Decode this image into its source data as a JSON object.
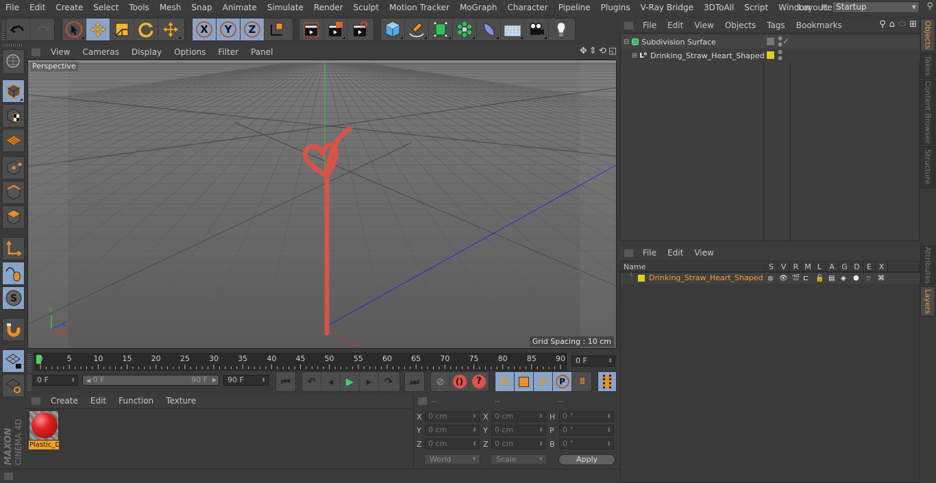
{
  "app": {
    "name": "Cinema 4D",
    "brand_vertical": "MAXON CINEMA 4D"
  },
  "menubar": {
    "items": [
      "File",
      "Edit",
      "Create",
      "Select",
      "Tools",
      "Mesh",
      "Snap",
      "Animate",
      "Simulate",
      "Render",
      "Sculpt",
      "Motion Tracker",
      "MoGraph",
      "Character",
      "Pipeline",
      "Plugins",
      "V-Ray Bridge",
      "3DToAll",
      "Script",
      "Window",
      "Help"
    ],
    "layout_label": "Layout:",
    "layout_value": "Startup"
  },
  "toolbar": {
    "icons": [
      "undo-icon",
      "redo-icon",
      "live-selection-icon",
      "move-icon",
      "scale-icon",
      "rotate-icon",
      "transform-icon",
      "x-axis-lock-icon",
      "y-axis-lock-icon",
      "z-axis-lock-icon",
      "coordinate-system-icon",
      "render-view-icon",
      "render-picture-viewer-icon",
      "render-settings-icon",
      "cube-icon",
      "pen-icon",
      "subdivision-icon",
      "mograph-cloner-icon",
      "deformer-icon",
      "floor-icon",
      "camera-icon",
      "light-icon"
    ]
  },
  "left_palette": {
    "icons": [
      "make-editable-icon",
      "model-mode-icon",
      "texture-mode-icon",
      "workplane-mode-icon",
      "points-mode-icon",
      "edges-mode-icon",
      "polygons-mode-icon",
      "axis-mode-icon",
      "tweak-mode-icon",
      "solo-mode-icon",
      "snapping-icon",
      "lock-workplane-icon",
      "workplane-align-icon"
    ]
  },
  "viewport": {
    "menu": [
      "View",
      "Cameras",
      "Display",
      "Options",
      "Filter",
      "Panel"
    ],
    "camera_label": "Perspective",
    "grid_spacing": "Grid Spacing : 10 cm",
    "axis_labels": {
      "x": "X",
      "y": "Y",
      "z": "Z"
    },
    "object_color": "#d9534a"
  },
  "timeline": {
    "ticks": [
      "0",
      "5",
      "10",
      "15",
      "20",
      "25",
      "30",
      "35",
      "40",
      "45",
      "50",
      "55",
      "60",
      "65",
      "70",
      "75",
      "80",
      "85",
      "90"
    ],
    "current_frame": "0 F",
    "start_field": "0 F",
    "range_start": "0 F",
    "range_end": "90 F",
    "end_field": "90 F",
    "min_frame": 0,
    "max_frame": 90,
    "playhead_frame": 0
  },
  "material_manager": {
    "menu": [
      "Create",
      "Edit",
      "Function",
      "Texture"
    ],
    "materials": [
      {
        "name": "Plastic_D",
        "color": "#d02020"
      }
    ]
  },
  "coordinates": {
    "headers": [
      "--",
      "--",
      "--"
    ],
    "rows": [
      {
        "pos_label": "X",
        "pos": "0 cm",
        "size_label": "X",
        "size": "0 cm",
        "rot_label": "H",
        "rot": "0 °"
      },
      {
        "pos_label": "Y",
        "pos": "0 cm",
        "size_label": "Y",
        "size": "0 cm",
        "rot_label": "P",
        "rot": "0 °"
      },
      {
        "pos_label": "Z",
        "pos": "0 cm",
        "size_label": "Z",
        "size": "0 cm",
        "rot_label": "B",
        "rot": "0 °"
      }
    ],
    "space_select": "World",
    "mode_select": "Scale",
    "apply_label": "Apply"
  },
  "object_manager": {
    "menu": [
      "File",
      "Edit",
      "View",
      "Objects",
      "Tags",
      "Bookmarks"
    ],
    "objects": [
      {
        "name": "Subdivision Surface",
        "icon": "subdivision-surface-icon",
        "expanded": true
      },
      {
        "name": "Drinking_Straw_Heart_Shaped",
        "icon": "null-object-icon",
        "expanded": false,
        "layer_color": "#e0d020"
      }
    ]
  },
  "side_tabs_top": [
    {
      "label": "Objects",
      "active": true
    },
    {
      "label": "Takes",
      "active": false
    },
    {
      "label": "Content Browser",
      "active": false
    },
    {
      "label": "Structure",
      "active": false
    }
  ],
  "side_tabs_bottom": [
    {
      "label": "Attributes",
      "active": false
    },
    {
      "label": "Layers",
      "active": true
    }
  ],
  "layer_manager": {
    "menu": [
      "File",
      "Edit",
      "View"
    ],
    "columns": [
      "Name",
      "S",
      "V",
      "R",
      "M",
      "L",
      "A",
      "G",
      "D",
      "E",
      "X"
    ],
    "layers": [
      {
        "name": "Drinking_Straw_Heart_Shaped",
        "color": "#e0d020",
        "text_color": "#f0a030"
      }
    ]
  }
}
